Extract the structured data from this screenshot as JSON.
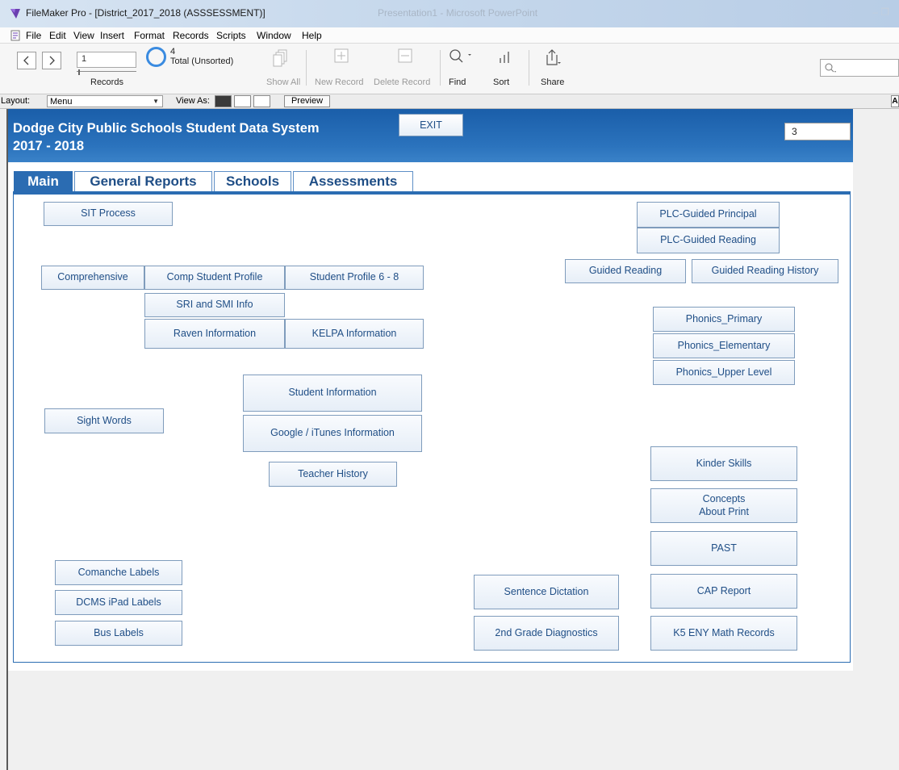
{
  "window": {
    "title": "FileMaker Pro - [District_2017_2018 (ASSSESSMENT)]",
    "other_window_title": "Presentation1 - Microsoft PowerPoint",
    "controls": "–  ❐"
  },
  "menu": [
    "File",
    "Edit",
    "View",
    "Insert",
    "Format",
    "Records",
    "Scripts",
    "Window",
    "Help"
  ],
  "toolbar": {
    "record_number": "1",
    "records_label": "Records",
    "found_count": "4",
    "found_status": "Total (Unsorted)",
    "buttons": {
      "show_all": "Show All",
      "new_record": "New Record",
      "delete_record": "Delete Record",
      "find": "Find",
      "sort": "Sort",
      "share": "Share"
    }
  },
  "layoutbar": {
    "layout_label": "Layout:",
    "layout_value": "Menu",
    "view_as_label": "View As:",
    "preview_label": "Preview",
    "aa_label": "A"
  },
  "header": {
    "title": "Dodge City Public Schools Student Data System",
    "year": "2017 - 2018",
    "exit_label": "EXIT",
    "field_value": "3"
  },
  "tabs": [
    "Main",
    "General Reports",
    "Schools",
    "Assessments"
  ],
  "main_buttons": {
    "sit_process": "SIT Process",
    "comprehensive": "Comprehensive",
    "comp_student_profile": "Comp Student Profile",
    "student_profile_6_8": "Student Profile 6 - 8",
    "sri_smi_info": "SRI and SMI Info",
    "raven_information": "Raven Information",
    "kelpa_information": "KELPA Information",
    "student_information": "Student Information",
    "google_itunes_information": "Google / iTunes Information",
    "teacher_history": "Teacher History",
    "sight_words": "Sight Words",
    "comanche_labels": "Comanche Labels",
    "dcms_ipad_labels": "DCMS iPad Labels",
    "bus_labels": "Bus Labels",
    "plc_guided_principal": "PLC-Guided Principal",
    "plc_guided_reading": "PLC-Guided Reading",
    "guided_reading": "Guided Reading",
    "guided_reading_history": "Guided Reading History",
    "phonics_primary": "Phonics_Primary",
    "phonics_elementary": "Phonics_Elementary",
    "phonics_upper_level": "Phonics_Upper Level",
    "kinder_skills": "Kinder Skills",
    "concepts_line1": "Concepts",
    "concepts_line2": "About Print",
    "past": "PAST",
    "cap_report": "CAP Report",
    "k5_eny_math_records": "K5 ENY Math Records",
    "sentence_dictation": "Sentence Dictation",
    "second_grade_diagnostics": "2nd Grade Diagnostics"
  }
}
